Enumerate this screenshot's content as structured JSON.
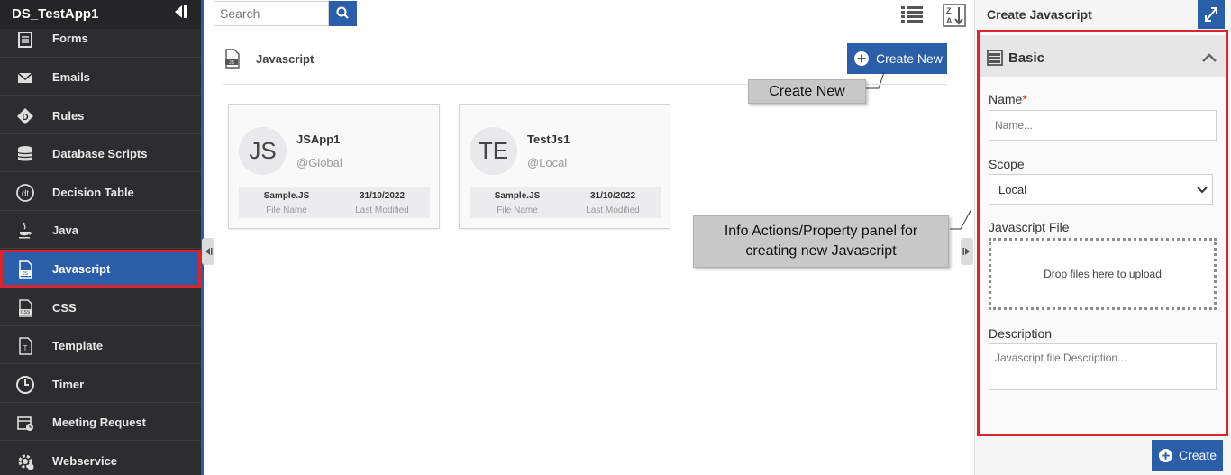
{
  "app": {
    "title": "DS_TestApp1"
  },
  "sidebar": {
    "items": [
      {
        "label": "Forms",
        "icon": "forms-icon"
      },
      {
        "label": "Emails",
        "icon": "mail-icon"
      },
      {
        "label": "Rules",
        "icon": "rules-icon"
      },
      {
        "label": "Database Scripts",
        "icon": "database-icon"
      },
      {
        "label": "Decision Table",
        "icon": "decision-table-icon"
      },
      {
        "label": "Java",
        "icon": "java-cup-icon"
      },
      {
        "label": "Javascript",
        "icon": "js-file-icon",
        "active": true
      },
      {
        "label": "CSS",
        "icon": "css-file-icon"
      },
      {
        "label": "Template",
        "icon": "template-icon"
      },
      {
        "label": "Timer",
        "icon": "clock-icon"
      },
      {
        "label": "Meeting Request",
        "icon": "calendar-icon"
      },
      {
        "label": "Webservice",
        "icon": "webservice-gear-icon"
      }
    ]
  },
  "search": {
    "placeholder": "Search"
  },
  "content": {
    "title": "Javascript",
    "create_new_label": "Create New",
    "cards": [
      {
        "initials": "JS",
        "name": "JSApp1",
        "scope": "@Global",
        "file_name": "Sample.JS",
        "file_name_label": "File Name",
        "last_modified": "31/10/2022",
        "last_modified_label": "Last Modified"
      },
      {
        "initials": "TE",
        "name": "TestJs1",
        "scope": "@Local",
        "file_name": "Sample.JS",
        "file_name_label": "File Name",
        "last_modified": "31/10/2022",
        "last_modified_label": "Last Modified"
      }
    ]
  },
  "callouts": {
    "create_new": "Create New",
    "info_panel_line1": "Info Actions/Property panel for",
    "info_panel_line2": "creating new Javascript"
  },
  "panel": {
    "title": "Create Javascript",
    "section_title": "Basic",
    "name_label": "Name",
    "name_required_mark": "*",
    "name_placeholder": "Name...",
    "scope_label": "Scope",
    "scope_value": "Local",
    "file_label": "Javascript File",
    "dropzone_text": "Drop files here to upload",
    "description_label": "Description",
    "description_placeholder": "Javascript file Description...",
    "create_label": "Create"
  },
  "colors": {
    "accent": "#2a5ea8",
    "highlight": "#d9262c",
    "sidebar_bg": "#2d2d30"
  }
}
